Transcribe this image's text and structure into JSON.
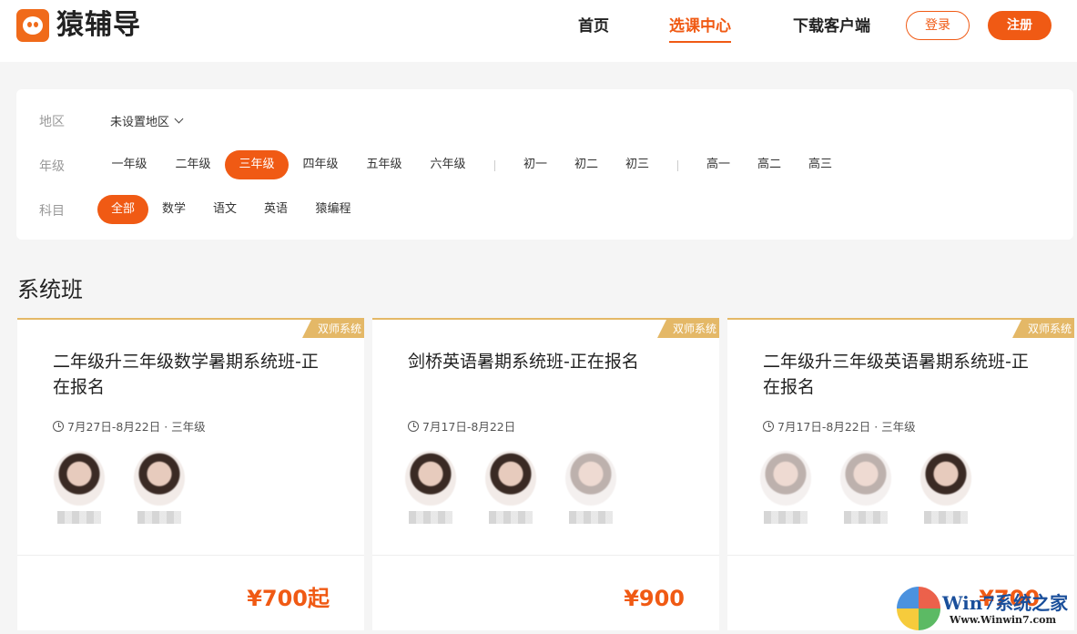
{
  "header": {
    "logo_text": "猿辅导",
    "nav": [
      "首页",
      "选课中心",
      "下载客户端"
    ],
    "login_label": "登录",
    "register_label": "注册"
  },
  "filters": {
    "region_label": "地区",
    "region_value": "未设置地区",
    "grade_label": "年级",
    "grades": [
      "一年级",
      "二年级",
      "三年级",
      "四年级",
      "五年级",
      "六年级",
      "初一",
      "初二",
      "初三",
      "高一",
      "高二",
      "高三"
    ],
    "grade_selected": "三年级",
    "subject_label": "科目",
    "subjects": [
      "全部",
      "数学",
      "语文",
      "英语",
      "猿编程"
    ],
    "subject_selected": "全部"
  },
  "section_title": "系统班",
  "cards": [
    {
      "badge": "双师系统",
      "title": "二年级升三年级数学暑期系统班-正在报名",
      "meta": "7月27日-8月22日 · 三年级",
      "teacher_count": 2,
      "price": "¥700起"
    },
    {
      "badge": "双师系统",
      "title": "剑桥英语暑期系统班-正在报名",
      "meta": "7月17日-8月22日",
      "teacher_count": 3,
      "price": "¥900"
    },
    {
      "badge": "双师系统",
      "title": "二年级升三年级英语暑期系统班-正在报名",
      "meta": "7月17日-8月22日 · 三年级",
      "teacher_count": 3,
      "price": "¥700"
    }
  ],
  "watermark": {
    "text": "Win7系统之家",
    "url": "Www.Winwin7.com"
  },
  "colors": {
    "accent": "#f05a14",
    "badge": "#e4b867",
    "background": "#f5f5f5"
  }
}
